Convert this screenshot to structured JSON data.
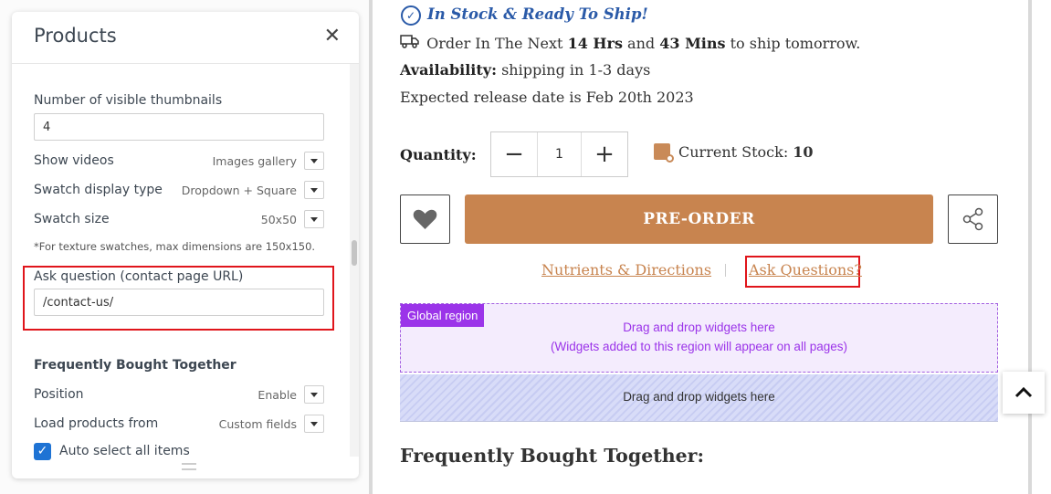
{
  "panel": {
    "title": "Products",
    "close_icon": "close-icon",
    "fields": {
      "thumbnails_label": "Number of visible thumbnails",
      "thumbnails_value": "4",
      "show_videos_label": "Show videos",
      "show_videos_value": "Images gallery",
      "swatch_type_label": "Swatch display type",
      "swatch_type_value": "Dropdown + Square",
      "swatch_size_label": "Swatch size",
      "swatch_size_value": "50x50",
      "texture_note": "*For texture swatches, max dimensions are 150x150.",
      "ask_question_label": "Ask question (contact page URL)",
      "ask_question_value": "/contact-us/"
    },
    "fbt": {
      "title": "Frequently Bought Together",
      "position_label": "Position",
      "position_value": "Enable",
      "load_from_label": "Load products from",
      "load_from_value": "Custom fields",
      "auto_select_label": "Auto select all items",
      "auto_select_checked": true
    }
  },
  "preview": {
    "stock_status": "In Stock & Ready To Ship!",
    "order_prefix": "Order In The Next",
    "order_hrs": "14 Hrs",
    "order_and": "and",
    "order_mins": "43 Mins",
    "order_suffix": "to ship tomorrow.",
    "availability_label": "Availability:",
    "availability_value": "shipping in 1-3 days",
    "release_text": "Expected release date is Feb 20th 2023",
    "quantity_label": "Quantity:",
    "quantity_value": "1",
    "current_stock_label": "Current Stock:",
    "current_stock_value": "10",
    "preorder_label": "PRE-ORDER",
    "nutrients_link": "Nutrients & Directions",
    "ask_link": "Ask Questions?",
    "global_region_tag": "Global region",
    "global_region_line1": "Drag and drop widgets here",
    "global_region_line2": "(Widgets added to this region will appear on all pages)",
    "drop_zone_text": "Drag and drop widgets here",
    "fbt_title": "Frequently Bought Together:"
  },
  "colors": {
    "accent_brown": "#c8844f",
    "stock_blue": "#2a5aa8",
    "highlight_red": "#e0151b",
    "region_purple": "#9b34e9",
    "checkbox_blue": "#1e73d4"
  }
}
